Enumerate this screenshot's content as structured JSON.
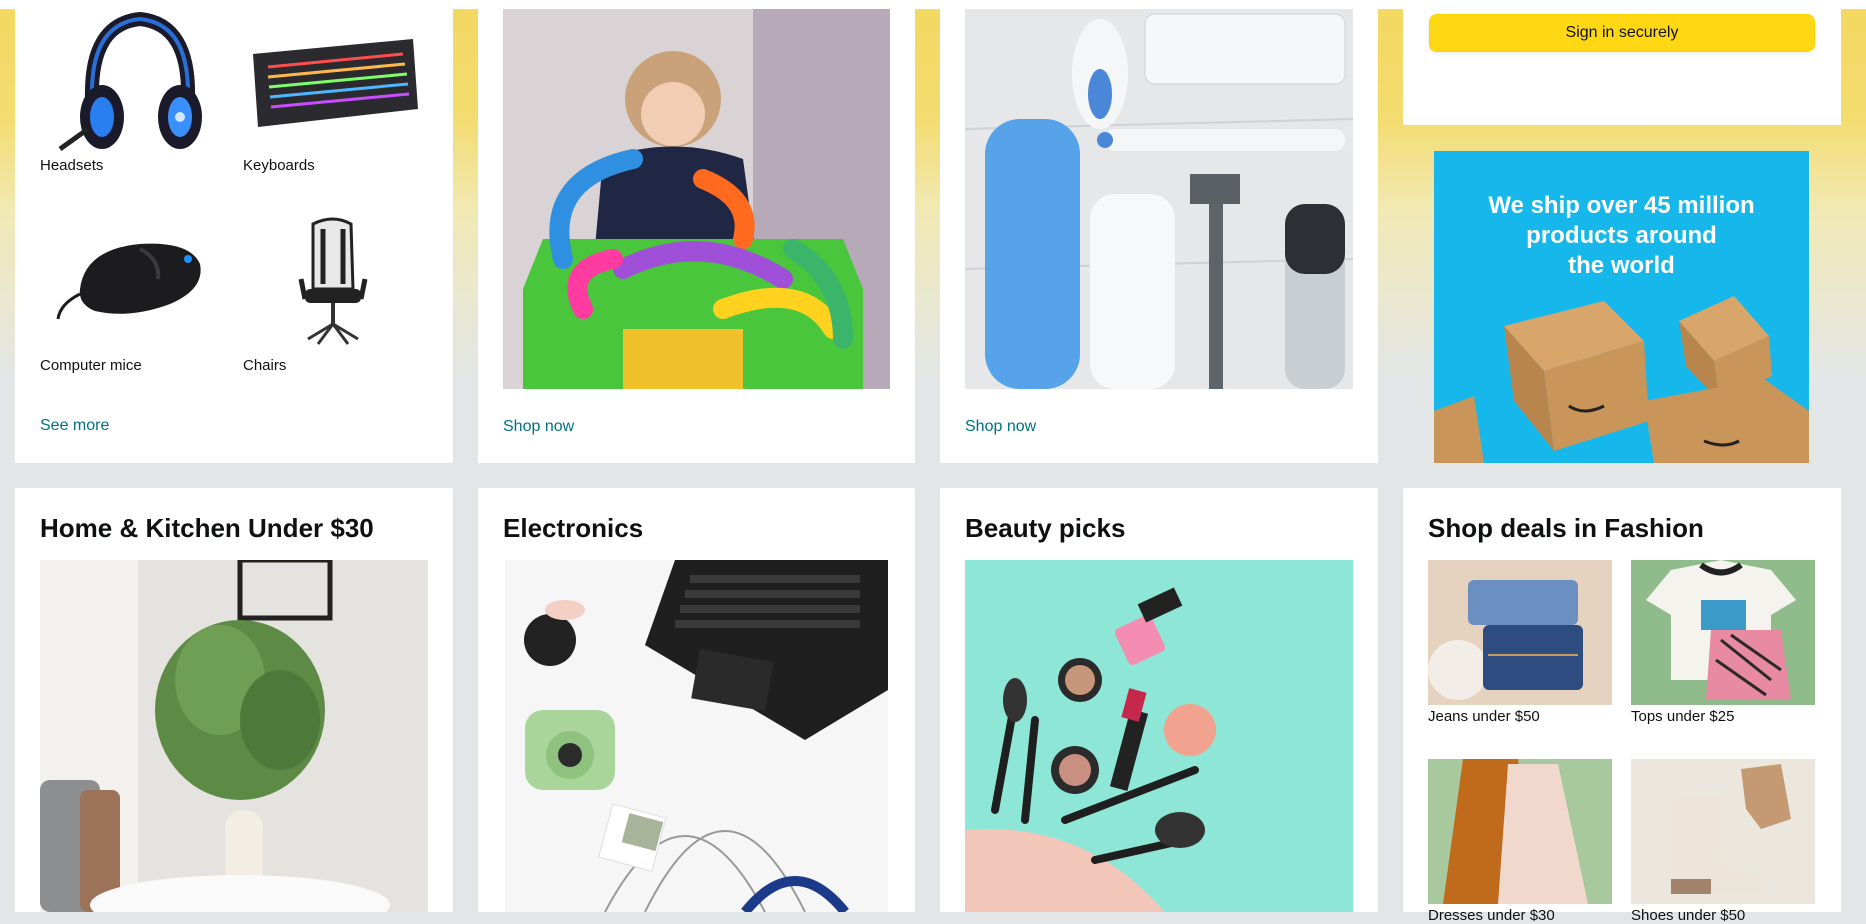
{
  "gaming_card": {
    "items": [
      {
        "label": "Headsets",
        "icon": "headset-icon"
      },
      {
        "label": "Keyboards",
        "icon": "keyboard-icon"
      },
      {
        "label": "Computer mice",
        "icon": "mouse-icon"
      },
      {
        "label": "Chairs",
        "icon": "chair-icon"
      }
    ],
    "see_more": "See more"
  },
  "toys_card": {
    "link": "Shop now"
  },
  "personal_care_card": {
    "link": "Shop now"
  },
  "sign_in_card": {
    "button": "Sign in securely"
  },
  "ship_ad": {
    "line1": "We ship over 45 million",
    "line2": "products around",
    "line3": "the world"
  },
  "home_kitchen_card": {
    "title": "Home & Kitchen Under $30"
  },
  "electronics_card": {
    "title": "Electronics"
  },
  "beauty_card": {
    "title": "Beauty picks"
  },
  "fashion_card": {
    "title": "Shop deals in Fashion",
    "items": [
      {
        "label": "Jeans under $50"
      },
      {
        "label": "Tops under $25"
      },
      {
        "label": "Dresses under $30"
      },
      {
        "label": "Shoes under $50"
      }
    ]
  },
  "colors": {
    "accent_yellow": "#ffd814",
    "link": "#007185",
    "background": "#e3e6e6",
    "ad_blue": "#16b8ec"
  }
}
